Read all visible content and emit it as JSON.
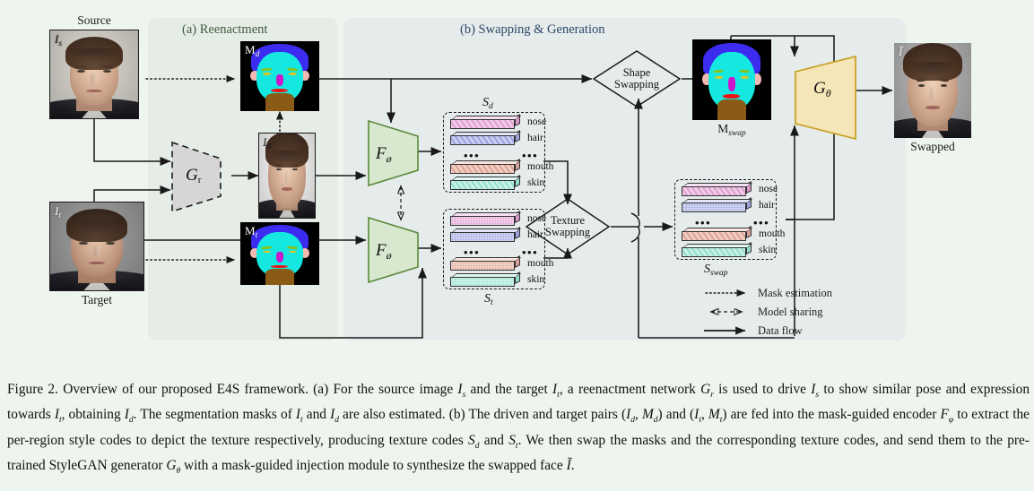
{
  "figure": {
    "panels": [
      {
        "id": "a",
        "title": "(a) Reenactment",
        "color": "#3d5c3d"
      },
      {
        "id": "b",
        "title": "(b) Swapping & Generation",
        "color": "#2d4668"
      }
    ],
    "images": [
      {
        "name": "source",
        "caption": "Source",
        "label": "I",
        "sub": "s"
      },
      {
        "name": "target",
        "caption": "Target",
        "label": "I",
        "sub": "t"
      },
      {
        "name": "driven",
        "caption": "",
        "label": "I",
        "sub": "d"
      },
      {
        "name": "swapped",
        "caption": "Swapped",
        "label": "Ĩ",
        "sub": ""
      }
    ],
    "masks": [
      {
        "name": "mask-driven",
        "label": "M",
        "sub": "d",
        "caption": ""
      },
      {
        "name": "mask-target",
        "label": "M",
        "sub": "t",
        "caption": ""
      },
      {
        "name": "mask-swap",
        "label": "",
        "sub": "",
        "caption": "M",
        "caption_sub": "swap"
      }
    ],
    "modules": [
      {
        "name": "reenactment-generator",
        "label": "G",
        "sub": "r",
        "style": "gray-dashed"
      },
      {
        "name": "encoder-driven",
        "label": "F",
        "sub": "ø",
        "style": "green"
      },
      {
        "name": "encoder-target",
        "label": "F",
        "sub": "ø",
        "style": "green"
      },
      {
        "name": "stylegan-generator",
        "label": "G",
        "sub": "θ",
        "style": "gold"
      }
    ],
    "operations": [
      {
        "name": "shape-swapping",
        "line1": "Shape",
        "line2": "Swapping"
      },
      {
        "name": "texture-swapping",
        "line1": "Texture",
        "line2": "Swapping"
      }
    ],
    "code_stacks": [
      {
        "name": "texture-codes-driven",
        "title": "S",
        "title_sub": "d",
        "pattern": "diagonal",
        "rows": [
          {
            "label": "nose",
            "color": "#f0cce8"
          },
          {
            "label": "hair",
            "color": "#ccd0f0"
          },
          {
            "label": "mouth",
            "color": "#f0cfc6"
          },
          {
            "label": "skin",
            "color": "#c9f0e6"
          }
        ],
        "ellipsis": "•••"
      },
      {
        "name": "texture-codes-target",
        "title": "S",
        "title_sub": "t",
        "pattern": "dotted",
        "rows": [
          {
            "label": "nose",
            "color": "#f0cce8"
          },
          {
            "label": "hair",
            "color": "#ccd0f0"
          },
          {
            "label": "mouth",
            "color": "#f0cfc6"
          },
          {
            "label": "skin",
            "color": "#c9f0e6"
          }
        ],
        "ellipsis": "•••"
      },
      {
        "name": "texture-codes-swapped",
        "title": "S",
        "title_sub": "swap",
        "pattern": "mixed",
        "rows": [
          {
            "label": "nose",
            "color": "#f0cce8",
            "pattern": "diagonal"
          },
          {
            "label": "hair",
            "color": "#ccd0f0",
            "pattern": "dotted"
          },
          {
            "label": "mouth",
            "color": "#f0cfc6",
            "pattern": "diagonal"
          },
          {
            "label": "skin",
            "color": "#c9f0e6",
            "pattern": "diagonal"
          }
        ],
        "ellipsis": "•••"
      }
    ],
    "legend": [
      {
        "name": "legend-mask-estimation",
        "label": "Mask estimation",
        "style": "dotted-arrow"
      },
      {
        "name": "legend-model-sharing",
        "label": "Model sharing",
        "style": "dashed-double-arrow"
      },
      {
        "name": "legend-data-flow",
        "label": "Data flow",
        "style": "solid-arrow"
      }
    ]
  },
  "caption": {
    "prefix": "Figure 2.",
    "text": " Overview of our proposed E4S framework. (a) For the source image Is and the target It, a reenactment network Gr is used to drive Is to show similar pose and expression towards It, obtaining Id. The segmentation masks of It and Id are also estimated. (b) The driven and target pairs (Id, Md) and (It, Mt) are fed into the mask-guided encoder Fφ to extract the per-region style codes to depict the texture respectively, producing texture codes Sd and St. We then swap the masks and the corresponding texture codes, and send them to the pre-trained StyleGAN generator Gθ with a mask-guided injection module to synthesize the swapped face Ĩ."
  },
  "colors": {
    "panel_a_bg": "#e6ece6",
    "panel_b_bg": "#e5eceb",
    "page_bg": "#eef4ee",
    "encoder_green": "#d8e8cf",
    "encoder_green_border": "#5b8a3c",
    "generator_gold": "#f5e6b8",
    "generator_gold_border": "#c9a227",
    "module_gray": "#d6d6d6"
  }
}
